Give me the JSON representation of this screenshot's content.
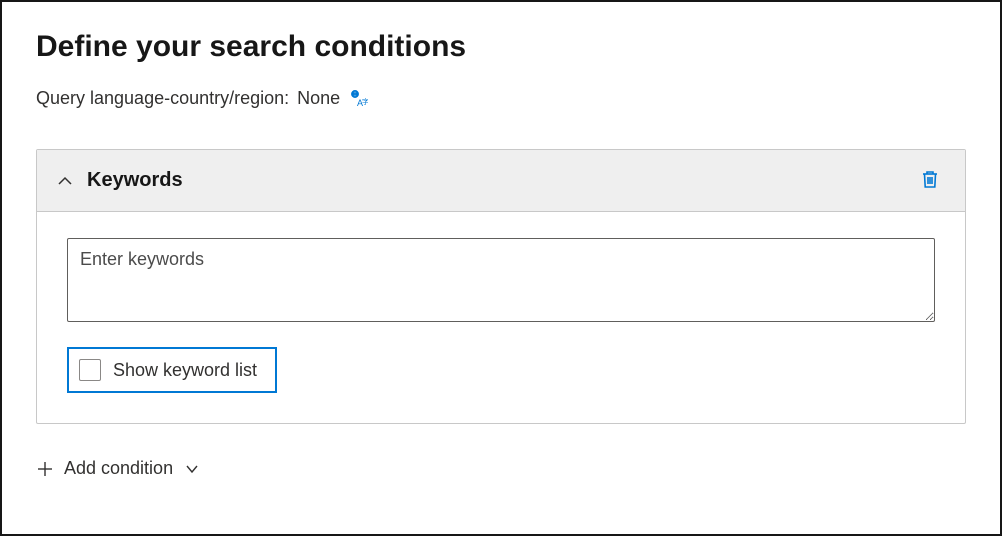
{
  "page": {
    "title": "Define your search conditions",
    "queryLanguageLabel": "Query language-country/region:",
    "queryLanguageValue": "None"
  },
  "keywordsPanel": {
    "title": "Keywords",
    "textareaPlaceholder": "Enter keywords",
    "textareaValue": "",
    "showKeywordListLabel": "Show keyword list",
    "showKeywordListChecked": false
  },
  "actions": {
    "addConditionLabel": "Add condition"
  },
  "colors": {
    "accent": "#0078d4"
  }
}
